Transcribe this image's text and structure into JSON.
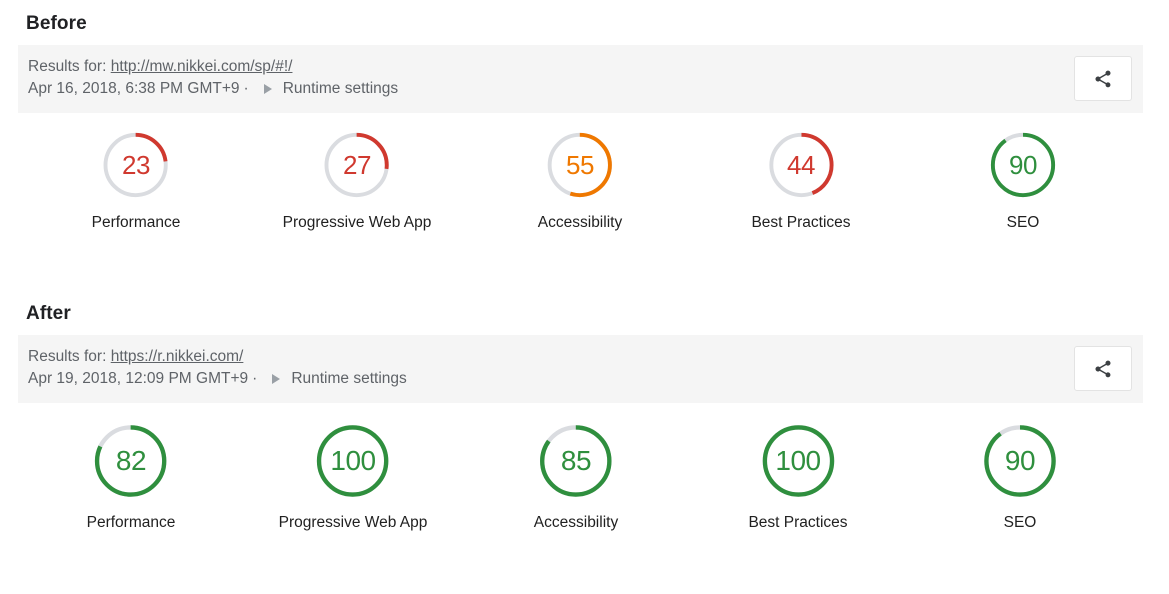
{
  "colors": {
    "fail": "#d0392f",
    "average": "#ef7800",
    "pass": "#2f8f3e",
    "track": "#dadce0",
    "bar_background": "#f5f5f5",
    "text": "#5f6368",
    "heading": "#202124"
  },
  "sections": [
    {
      "id": "before",
      "title": "Before",
      "results_prefix": "Results for:",
      "url": "http://mw.nikkei.com/sp/#!/",
      "timestamp": "Apr 16, 2018, 6:38 PM GMT+9",
      "separator": "·",
      "runtime_settings_label": "Runtime settings",
      "share_icon": "share-icon",
      "disclosure_icon": "triangle-right-icon",
      "gauge_centers": [
        136,
        357,
        580,
        801,
        1023
      ],
      "gauges": [
        {
          "label": "Performance",
          "score": 23,
          "status": "fail"
        },
        {
          "label": "Progressive Web App",
          "score": 27,
          "status": "fail"
        },
        {
          "label": "Accessibility",
          "score": 55,
          "status": "average"
        },
        {
          "label": "Best Practices",
          "score": 44,
          "status": "fail"
        },
        {
          "label": "SEO",
          "score": 90,
          "status": "pass"
        }
      ]
    },
    {
      "id": "after",
      "title": "After",
      "results_prefix": "Results for:",
      "url": "https://r.nikkei.com/",
      "timestamp": "Apr 19, 2018, 12:09 PM GMT+9",
      "separator": "·",
      "runtime_settings_label": "Runtime settings",
      "share_icon": "share-icon",
      "disclosure_icon": "triangle-right-icon",
      "gauge_centers": [
        131,
        353,
        576,
        798,
        1020
      ],
      "gauges": [
        {
          "label": "Performance",
          "score": 82,
          "status": "pass"
        },
        {
          "label": "Progressive Web App",
          "score": 100,
          "status": "pass"
        },
        {
          "label": "Accessibility",
          "score": 85,
          "status": "pass"
        },
        {
          "label": "Best Practices",
          "score": 100,
          "status": "pass"
        },
        {
          "label": "SEO",
          "score": 90,
          "status": "pass"
        }
      ]
    }
  ]
}
